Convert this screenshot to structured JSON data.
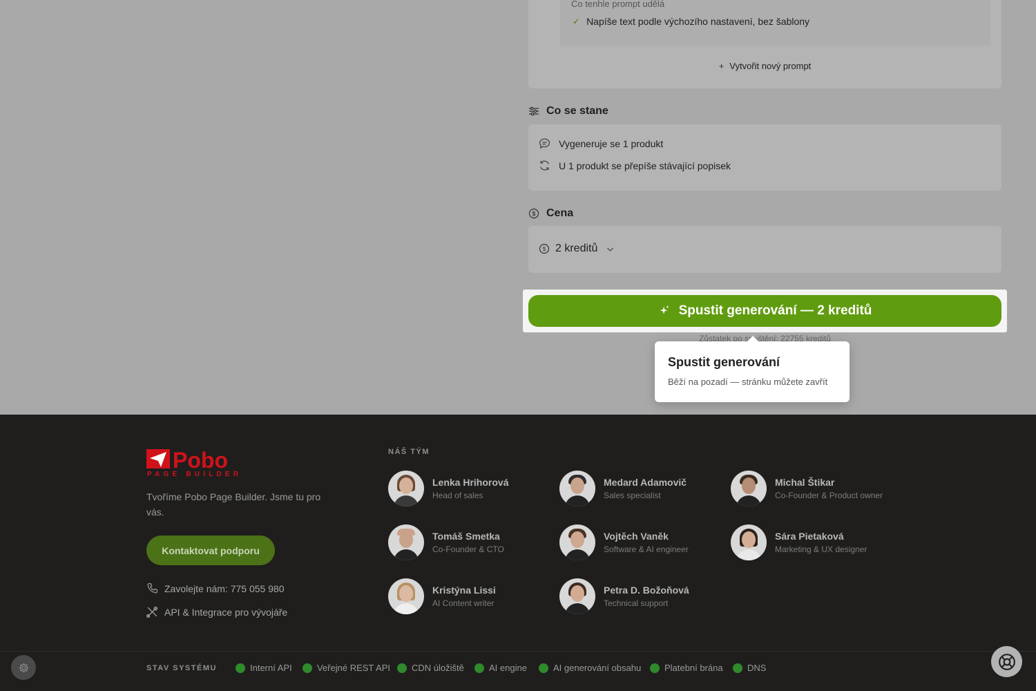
{
  "prompt": {
    "section_title": "Co tenhle prompt udělá",
    "item": "Napíše text podle výchozího nastavení, bez šablony",
    "new_prompt": "Vytvořit nový prompt"
  },
  "what_happens": {
    "title": "Co se stane",
    "rows": [
      "Vygeneruje se 1 produkt",
      "U 1 produkt se přepíše stávající popisek"
    ]
  },
  "price": {
    "title": "Cena",
    "value": "2 kreditů"
  },
  "run_button": {
    "label": "Spustit generování — 2 kreditů"
  },
  "remaining": "Zůstatek po spuštění: 22755 kreditů",
  "tooltip": {
    "title": "Spustit generování",
    "subtitle": "Běží na pozadí — stránku můžete zavřít"
  },
  "footer": {
    "logo_text": "Pobo",
    "logo_sub": "PAGE BUILDER",
    "tagline": "Tvoříme Pobo Page Builder. Jsme tu pro vás.",
    "contact_button": "Kontaktovat podporu",
    "phone": "Zavolejte nám: 775 055 980",
    "api": "API & Integrace pro vývojáře",
    "team_label": "NÁŠ TÝM",
    "team": [
      {
        "name": "Lenka Hrihorová",
        "role": "Head of sales"
      },
      {
        "name": "Medard Adamovič",
        "role": "Sales specialist"
      },
      {
        "name": "Michal Štikar",
        "role": "Co-Founder & Product owner"
      },
      {
        "name": "Tomáš Smetka",
        "role": "Co-Founder & CTO"
      },
      {
        "name": "Vojtěch Vaněk",
        "role": "Software & AI engineer"
      },
      {
        "name": "Sára Pietaková",
        "role": "Marketing & UX designer"
      },
      {
        "name": "Kristýna Lissi",
        "role": "AI Content writer"
      },
      {
        "name": "Petra D. Božoňová",
        "role": "Technical support"
      }
    ],
    "status_label": "STAV SYSTÉMU",
    "status": [
      "Interní API",
      "Veřejné REST API",
      "CDN úložiště",
      "AI engine",
      "AI generování obsahu",
      "Platební brána",
      "DNS"
    ]
  },
  "colors": {
    "accent": "#609c0f",
    "footer_bg": "#1f1e1d",
    "status_ok": "#2f8a2b",
    "brand_red": "#d0121b"
  }
}
